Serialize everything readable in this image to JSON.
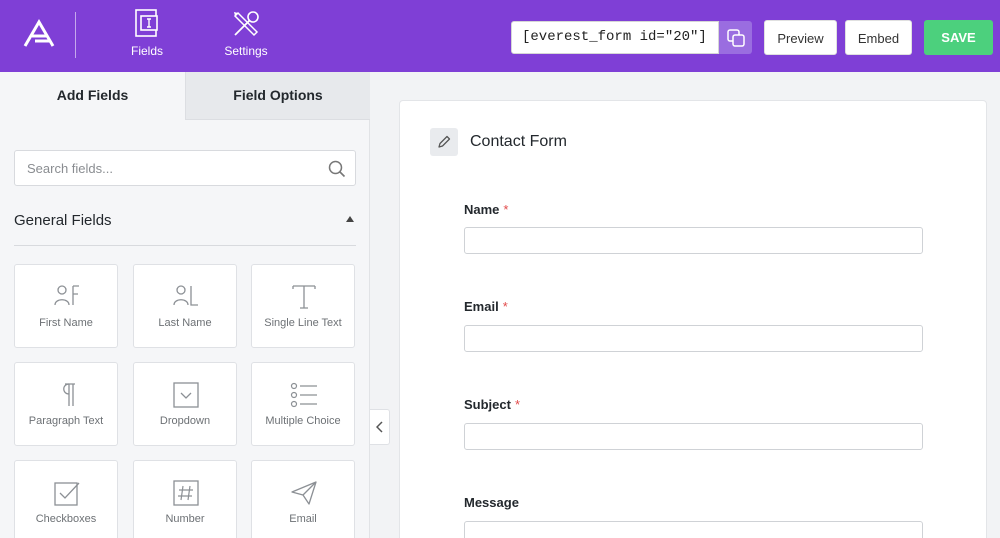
{
  "colors": {
    "header_bg": "#7f3fd6",
    "save_bg": "#4cd07d",
    "required": "#e24a4a"
  },
  "header": {
    "nav": [
      {
        "label": "Fields",
        "icon": "form-fields-icon"
      },
      {
        "label": "Settings",
        "icon": "tools-icon"
      }
    ],
    "shortcode": "[everest_form id=\"20\"]",
    "preview_label": "Preview",
    "embed_label": "Embed",
    "save_label": "SAVE"
  },
  "sidebar": {
    "tabs": [
      "Add Fields",
      "Field Options"
    ],
    "search_placeholder": "Search fields...",
    "section_title": "General Fields",
    "fields": [
      {
        "label": "First Name",
        "icon": "first-name-icon"
      },
      {
        "label": "Last Name",
        "icon": "last-name-icon"
      },
      {
        "label": "Single Line Text",
        "icon": "text-icon"
      },
      {
        "label": "Paragraph Text",
        "icon": "paragraph-icon"
      },
      {
        "label": "Dropdown",
        "icon": "dropdown-icon"
      },
      {
        "label": "Multiple Choice",
        "icon": "multiple-choice-icon"
      },
      {
        "label": "Checkboxes",
        "icon": "checkbox-icon"
      },
      {
        "label": "Number",
        "icon": "number-icon"
      },
      {
        "label": "Email",
        "icon": "paper-plane-icon"
      }
    ]
  },
  "form": {
    "title": "Contact Form",
    "fields": [
      {
        "label": "Name",
        "required_mark": "*"
      },
      {
        "label": "Email",
        "required_mark": "*"
      },
      {
        "label": "Subject",
        "required_mark": "*"
      },
      {
        "label": "Message",
        "required_mark": ""
      }
    ]
  }
}
